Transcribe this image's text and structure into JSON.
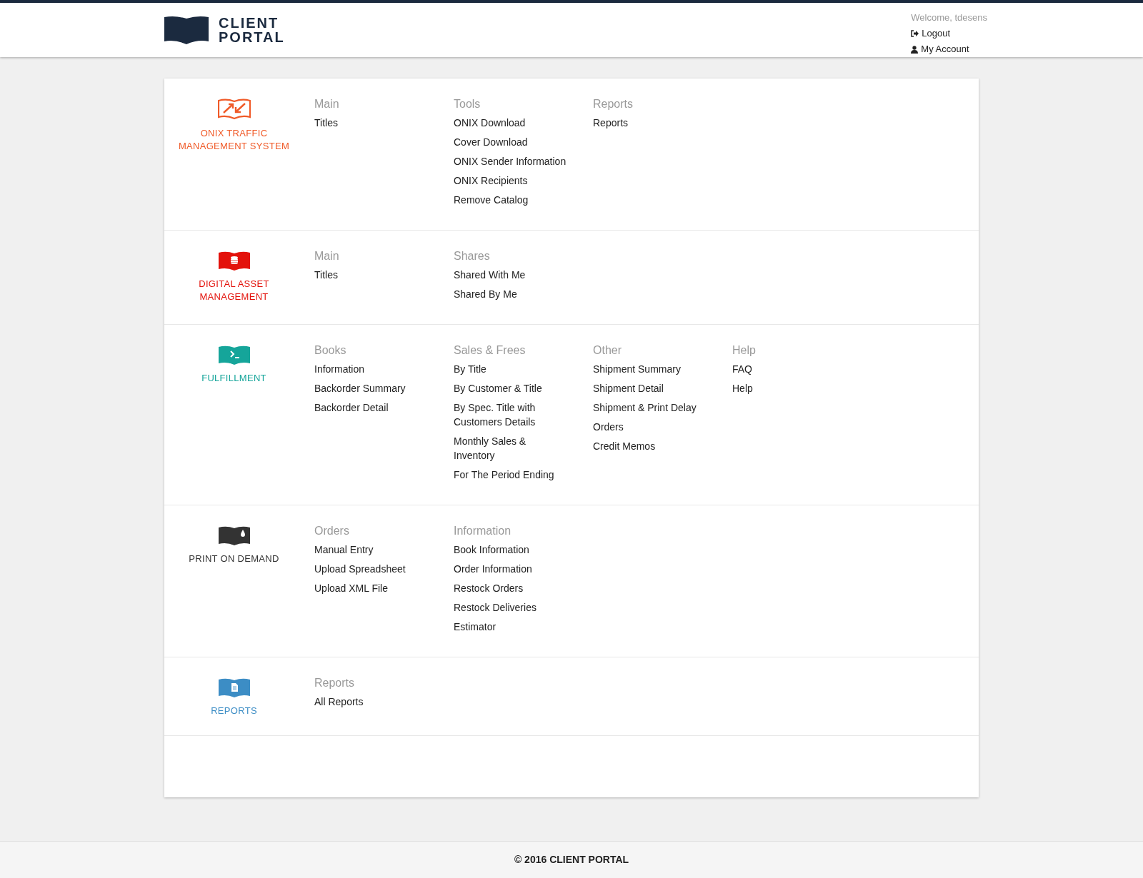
{
  "header": {
    "logo_text": [
      "CLIENT",
      "PORTAL"
    ],
    "welcome": "Welcome, tdesens",
    "links": [
      {
        "kind": "logout",
        "label": "Logout"
      },
      {
        "kind": "account",
        "label": "My Account"
      }
    ]
  },
  "sections": [
    {
      "kind": "onix",
      "title": "ONIX TRAFFIC MANAGEMENT SYSTEM",
      "color": "#f05a28",
      "groups": [
        {
          "heading": "Main",
          "links": [
            "Titles"
          ]
        },
        {
          "heading": "Tools",
          "links": [
            "ONIX Download",
            "Cover Download",
            "ONIX Sender Information",
            "ONIX Recipients",
            "Remove Catalog"
          ]
        },
        {
          "heading": "Reports",
          "links": [
            "Reports"
          ]
        }
      ]
    },
    {
      "kind": "dam",
      "title": "DIGITAL ASSET MANAGEMENT",
      "color": "#e3120b",
      "groups": [
        {
          "heading": "Main",
          "links": [
            "Titles"
          ]
        },
        {
          "heading": "Shares",
          "links": [
            "Shared With Me",
            "Shared By Me"
          ]
        }
      ]
    },
    {
      "kind": "fulfillment",
      "title": "FULFILLMENT",
      "color": "#15a59a",
      "groups": [
        {
          "heading": "Books",
          "links": [
            "Information",
            "Backorder Summary",
            "Backorder Detail"
          ]
        },
        {
          "heading": "Sales & Frees",
          "links": [
            "By Title",
            "By Customer & Title",
            "By Spec. Title with Customers Details",
            "Monthly Sales & Inventory",
            "For The Period Ending"
          ]
        },
        {
          "heading": "Other",
          "links": [
            "Shipment Summary",
            "Shipment Detail",
            "Shipment & Print Delay",
            "Orders",
            "Credit Memos"
          ]
        },
        {
          "heading": "Help",
          "links": [
            "FAQ",
            "Help"
          ]
        }
      ]
    },
    {
      "kind": "pod",
      "title": "PRINT ON DEMAND",
      "color": "#333333",
      "groups": [
        {
          "heading": "Orders",
          "links": [
            "Manual Entry",
            "Upload Spreadsheet",
            "Upload XML File"
          ]
        },
        {
          "heading": "Information",
          "links": [
            "Book Information",
            "Order Information",
            "Restock Orders",
            "Restock Deliveries",
            "Estimator"
          ]
        }
      ]
    },
    {
      "kind": "reports",
      "title": "REPORTS",
      "color": "#3c8dc5",
      "groups": [
        {
          "heading": "Reports",
          "links": [
            "All Reports"
          ]
        }
      ]
    }
  ],
  "footer": "© 2016 CLIENT PORTAL"
}
